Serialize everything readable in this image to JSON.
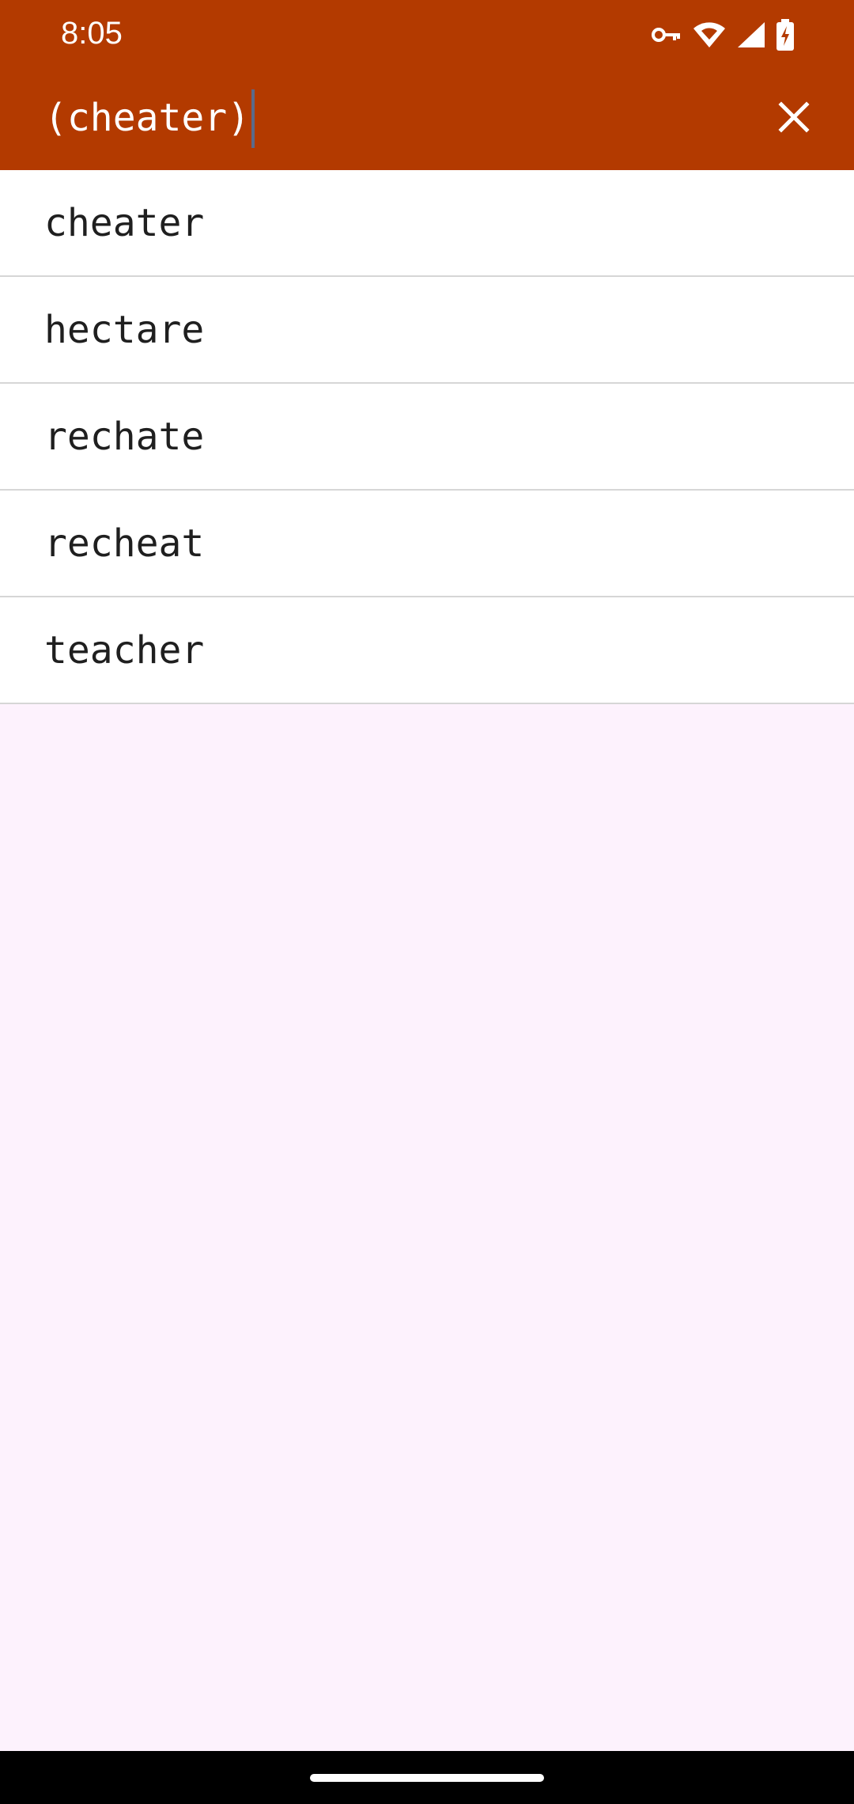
{
  "status_bar": {
    "time": "8:05",
    "icons": [
      "vpn-key-icon",
      "wifi-icon",
      "cell-signal-icon",
      "battery-charging-icon"
    ]
  },
  "search": {
    "query": "(cheater)",
    "clear_icon": "close-icon"
  },
  "results": [
    {
      "word": "cheater"
    },
    {
      "word": "hectare"
    },
    {
      "word": "rechate"
    },
    {
      "word": "recheat"
    },
    {
      "word": "teacher"
    }
  ],
  "colors": {
    "toolbar": "#b33a00",
    "background": "#fdf2fd",
    "divider": "#d6d6d6",
    "text": "#1f1f1f"
  }
}
